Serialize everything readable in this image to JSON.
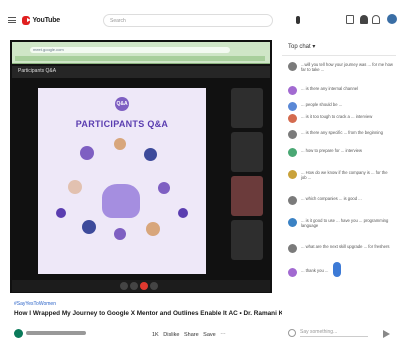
{
  "header": {
    "logo_text": "YouTube",
    "search_placeholder": "Search",
    "icons": [
      "menu-icon",
      "search-icon",
      "mic-icon",
      "create-video-icon",
      "notifications-icon",
      "apps-icon",
      "avatar"
    ]
  },
  "video": {
    "browser_url": "meet.google.com",
    "meeting_title": "Participants Q&A",
    "slide": {
      "badge": "Q&A",
      "title": "PARTICIPANTS Q&A"
    }
  },
  "below_video": {
    "meta": "#SayYesToWomen",
    "title": "How I Wrapped My Journey to Google X Mentor and Outlines Enable It AC • Dr. Ramani Karma",
    "actions": "1K  Dislike  Share  Save  ⋯"
  },
  "chat": {
    "header": "Top chat ▾",
    "input_placeholder": "Say something...",
    "messages": [
      {
        "text": "...will you tell how your journey was ... for me how far to take ...",
        "color": "#7b7b7b"
      },
      {
        "text": "... is there any internal channel",
        "color": "#a26ad1"
      },
      {
        "text": "... people should be ...",
        "color": "#5a88d6"
      },
      {
        "text": "... is it too tough to crack a ... interview",
        "color": "#d46b4f"
      },
      {
        "text": "... is there any specific ... from the beginning",
        "color": "#7b7b7b"
      },
      {
        "text": "... how to prepare for ... interview",
        "color": "#4aa874"
      },
      {
        "text": "... How do we know if the company is ... for the job ...",
        "color": "#c9a23a"
      },
      {
        "text": "... which companies ... is good ...",
        "color": "#7b7b7b"
      },
      {
        "text": "... is it good to use ... have you ... programming language",
        "color": "#3b82c4"
      },
      {
        "text": "... what are the next skill upgrade ... for freshers",
        "color": "#7b7b7b"
      },
      {
        "text": "... thank you ...",
        "color": "#a26ad1"
      }
    ]
  }
}
